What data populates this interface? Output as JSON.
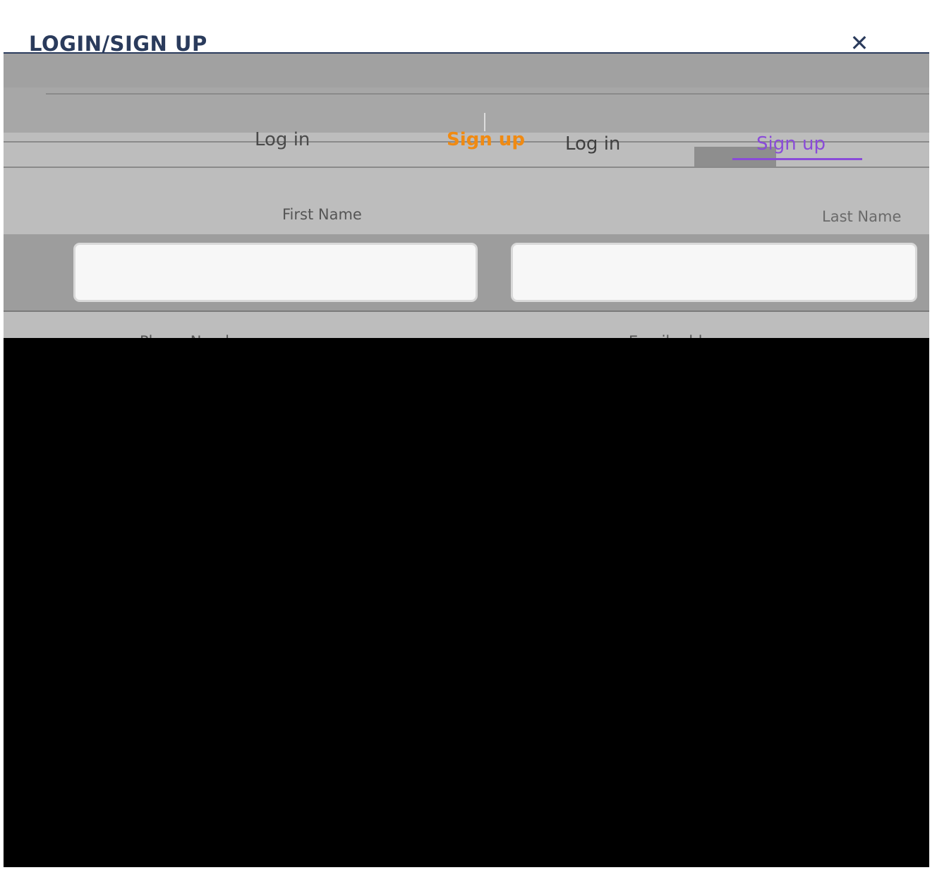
{
  "modal": {
    "title": "LOGIN/SIGN UP",
    "close_glyph": "✕",
    "close_icon": "close-icon"
  },
  "tabs": [
    {
      "label": "Log in",
      "active": false
    },
    {
      "label": "Sign up",
      "active": true
    }
  ],
  "tabs_ghost": [
    {
      "label": "Log in"
    },
    {
      "label": "Sign up"
    }
  ],
  "form": {
    "first_name": {
      "label": "First Name",
      "value": "",
      "placeholder": ""
    },
    "last_name": {
      "label": "Last Name",
      "value": "",
      "placeholder": ""
    },
    "phone": {
      "label": "Phone Number"
    },
    "email": {
      "label": "Email address"
    }
  },
  "colors": {
    "title": "#2a3b5c",
    "active_tab": "#f08a12",
    "accent": "#8a4bd8",
    "field_bg": "#f7f7f7"
  }
}
